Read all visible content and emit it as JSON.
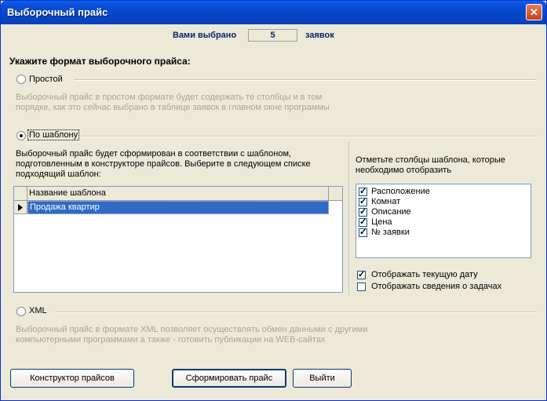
{
  "window": {
    "title": "Выборочный прайс",
    "close_icon": "close-icon"
  },
  "count": {
    "prefix": "Вами выбрано",
    "value": "5",
    "suffix": "заявок"
  },
  "format_heading": "Укажите формат выборочного прайса:",
  "options": {
    "simple": {
      "label": "Простой",
      "selected": false,
      "description_line1": "Выборочный прайс в простом формате будет содержать те столбцы и в том",
      "description_line2": "порядке, как это сейчас выбрано в таблице заявок в главном окне программы"
    },
    "template": {
      "label": "По шаблону",
      "selected": true,
      "description_line1": "Выборочный прайс будет сформирован в соответствии с шаблоном,",
      "description_line2": "подготовленным в конструкторе прайсов. Выберите в следующем списке",
      "description_line3": "подходящий шаблон:",
      "grid_header": "Название шаблона",
      "rows": [
        "Продажа квартир"
      ],
      "columns_prompt_line1": "Отметьте столбцы шаблона, которые",
      "columns_prompt_line2": "необходимо отобразить",
      "columns": [
        {
          "label": "Расположение",
          "checked": true
        },
        {
          "label": "Комнат",
          "checked": true
        },
        {
          "label": "Описание",
          "checked": true
        },
        {
          "label": "Цена",
          "checked": true
        },
        {
          "label": "№ заявки",
          "checked": true
        }
      ],
      "show_date": {
        "label": "Отображать текущую дату",
        "checked": true
      },
      "show_tasks": {
        "label": "Отображать сведения о задачах",
        "checked": false
      }
    },
    "xml": {
      "label": "XML",
      "selected": false,
      "description_line1": "Выборочный прайс в формате XML позволяет осуществлять обмен данными с другими",
      "description_line2": "компьютерными программами а также - готовить публикации на WEB-сайтах"
    }
  },
  "buttons": {
    "constructor": "Конструктор прайсов",
    "generate": "Сформировать прайс",
    "exit": "Выйти"
  },
  "colors": {
    "titlebar": "#0a4fd8",
    "selection": "#316ac5",
    "face": "#ece9d8"
  }
}
